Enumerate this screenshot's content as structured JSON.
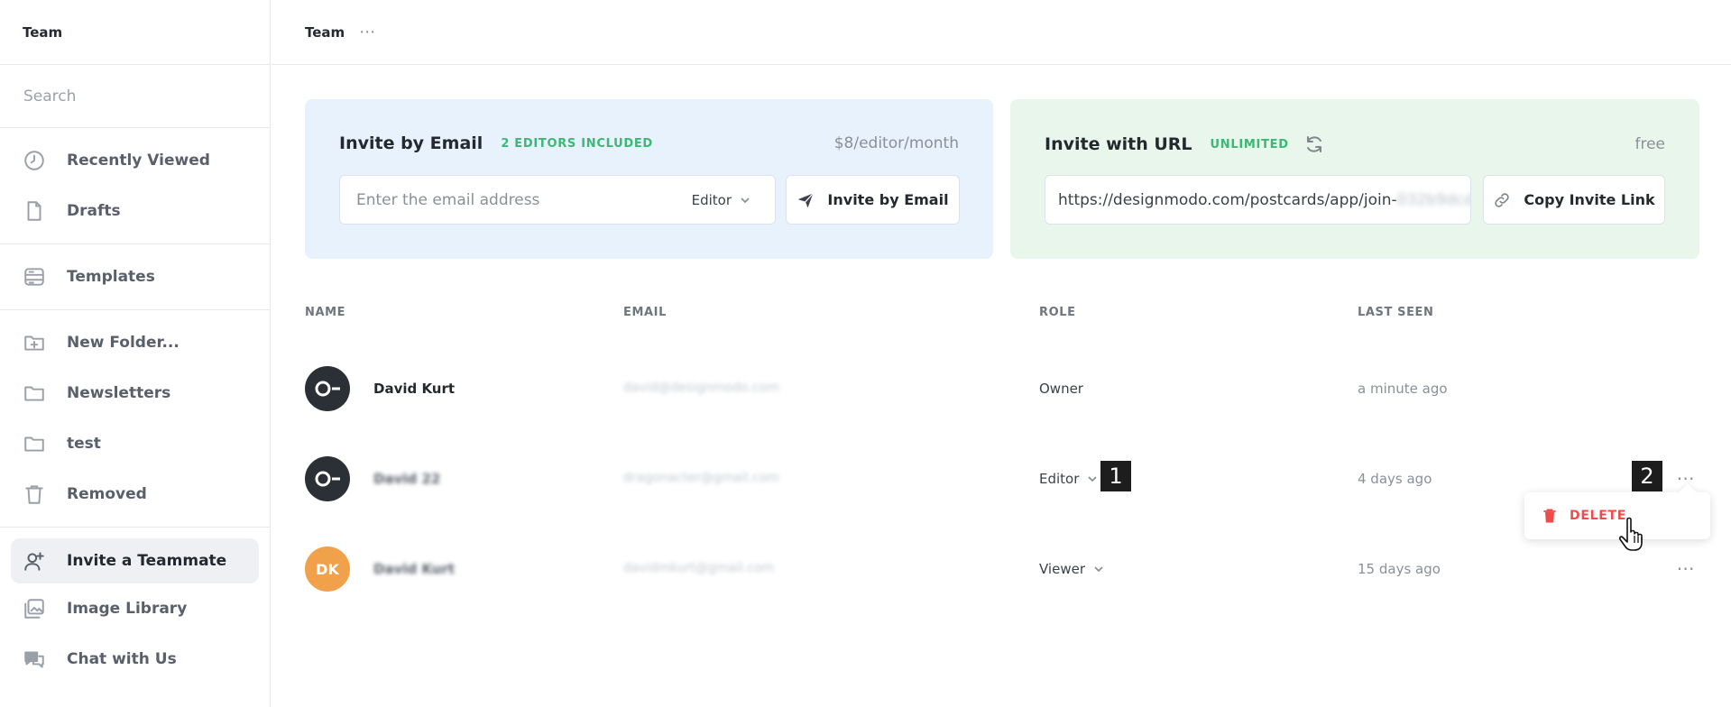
{
  "sidebar": {
    "title": "Team",
    "search_placeholder": "Search",
    "items": [
      {
        "label": "Recently Viewed",
        "icon": "clock-icon"
      },
      {
        "label": "Drafts",
        "icon": "document-icon"
      },
      {
        "label": "Templates",
        "icon": "templates-icon"
      },
      {
        "label": "New Folder...",
        "icon": "folder-plus-icon"
      },
      {
        "label": "Newsletters",
        "icon": "folder-icon"
      },
      {
        "label": "test",
        "icon": "folder-icon"
      },
      {
        "label": "Removed",
        "icon": "trash-icon"
      },
      {
        "label": "Invite a Teammate",
        "icon": "user-plus-icon"
      },
      {
        "label": "Image Library",
        "icon": "image-library-icon"
      },
      {
        "label": "Chat with Us",
        "icon": "chat-icon"
      }
    ]
  },
  "header": {
    "title": "Team",
    "more": "⋯"
  },
  "invite_email": {
    "title": "Invite by Email",
    "badge": "2 EDITORS INCLUDED",
    "price": "$8/editor/month",
    "placeholder": "Enter the email address",
    "role": "Editor",
    "button": "Invite by Email"
  },
  "invite_url": {
    "title": "Invite with URL",
    "badge": "UNLIMITED",
    "price": "free",
    "url_visible": "https://designmodo.com/postcards/app/join-",
    "url_hidden": "032b9dcd",
    "button": "Copy Invite Link"
  },
  "table": {
    "headers": {
      "name": "NAME",
      "email": "EMAIL",
      "role": "ROLE",
      "last_seen": "LAST SEEN"
    },
    "rows": [
      {
        "avatar": "",
        "name": "David Kurt",
        "email": "david@designmodo.com",
        "role": "Owner",
        "last_seen": "a minute ago"
      },
      {
        "avatar": "",
        "name": "David 22",
        "email": "dragonacter@gmail.com",
        "role": "Editor",
        "last_seen": "4 days ago"
      },
      {
        "avatar": "DK",
        "name": "David Kurt",
        "email": "davidmkurt@gmail.com",
        "role": "Viewer",
        "last_seen": "15 days ago"
      }
    ],
    "more": "⋯"
  },
  "markers": {
    "one": "1",
    "two": "2"
  },
  "row_menu": {
    "delete": "DELETE"
  },
  "colors": {
    "accent_green": "#3bb873",
    "danger": "#ef4b4b",
    "email_card_bg": "#e7f2fc",
    "url_card_bg": "#e8f6ec"
  }
}
